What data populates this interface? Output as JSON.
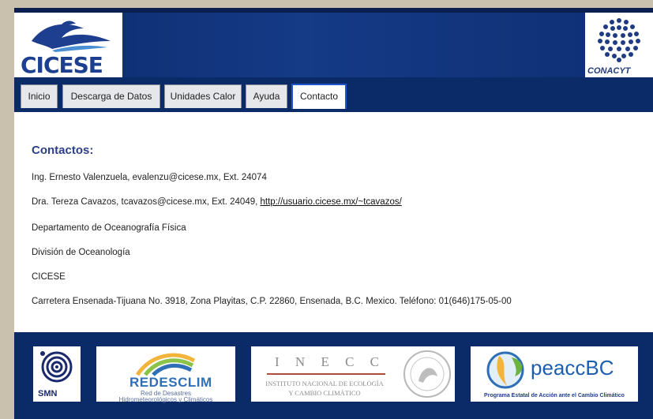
{
  "header": {
    "logo_text": "CICESE",
    "right_logo_text": "CONACYT"
  },
  "nav": {
    "tabs": [
      {
        "label": "Inicio"
      },
      {
        "label": "Descarga de Datos"
      },
      {
        "label": "Unidades Calor"
      },
      {
        "label": "Ayuda"
      },
      {
        "label": "Contacto",
        "active": true
      }
    ]
  },
  "content": {
    "heading": "Contactos:",
    "contact1": "Ing. Ernesto Valenzuela, evalenzu@cicese.mx, Ext. 24074",
    "contact2_prefix": "Dra. Tereza Cavazos, tcavazos@cicese.mx, Ext. 24049, ",
    "contact2_link": "http://usuario.cicese.mx/~tcavazos/",
    "department": "Departamento de Oceanografía Física",
    "division": "División de Oceanología",
    "institution": "CICESE",
    "address": "Carretera Ensenada-Tijuana No. 3918, Zona Playitas, C.P. 22860, Ensenada, B.C. Mexico. Teléfono: 01(646)175-05-00"
  },
  "footer": {
    "logos": {
      "smn": "SMN",
      "redesc_title": "REDESCLIM",
      "redesc_line1": "Red de Desastres",
      "redesc_line2": "Hidrometeorológicos y Climáticos",
      "inecc_letters": "I N E C C",
      "inecc_line1": "INSTITUTO NACIONAL DE ECOLOGÍA",
      "inecc_line2": "Y CAMBIO CLIMÁTICO",
      "peacc_title": "peaccBC",
      "peacc_sub": "Programa Estatal de Acción ante el Cambio Climático"
    }
  },
  "colors": {
    "navy": "#0b2a68",
    "heading": "#2d3f86",
    "active_tab_border": "#1f56c8"
  }
}
